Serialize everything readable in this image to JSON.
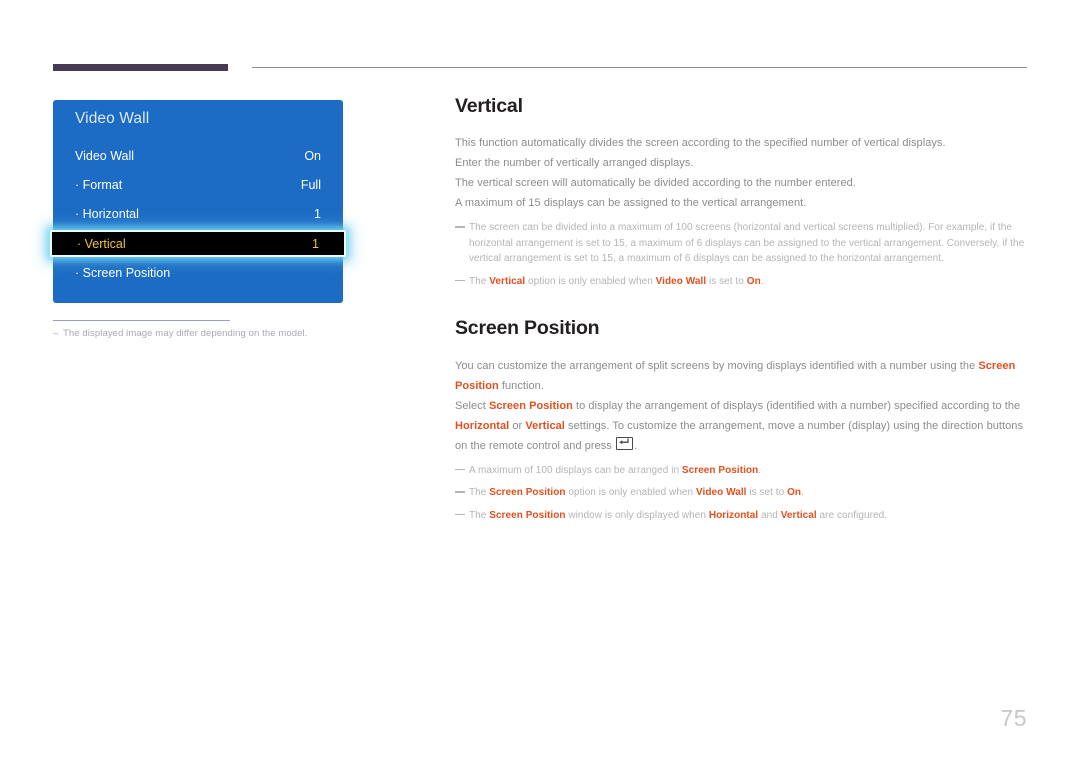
{
  "page": {
    "number": "75",
    "accent_color": "#E1511F",
    "osd_blue": "#1C6BC4",
    "osd_highlight_text": "#F5C13B",
    "rule_color": "#453B53"
  },
  "osd": {
    "title": "Video Wall",
    "rows": [
      {
        "label": "Video Wall",
        "value": "On",
        "selected": false
      },
      {
        "label": "· Format",
        "value": "Full",
        "selected": false
      },
      {
        "label": "· Horizontal",
        "value": "1",
        "selected": false
      },
      {
        "label": "· Vertical",
        "value": "1",
        "selected": true
      },
      {
        "label": "· Screen Position",
        "value": "",
        "selected": false
      }
    ],
    "caption": "The displayed image may differ depending on the model.",
    "caption_dash": "‒"
  },
  "article": {
    "vertical": {
      "heading": "Vertical",
      "paragraphs": [
        "This function automatically divides the screen according to the specified number of vertical displays.",
        "Enter the number of vertically arranged displays.",
        "The vertical screen will automatically be divided according to the number entered.",
        "A maximum of 15 displays can be assigned to the vertical arrangement."
      ],
      "note1": "The screen can be divided into a maximum of 100 screens (horizontal and vertical screens multiplied). For example, if the horizontal arrangement is set to 15, a maximum of 6 displays can be assigned to the vertical arrangement. Conversely, if the vertical arrangement is set to 15, a maximum of 6 displays can be assigned to the horizontal arrangement.",
      "note2": {
        "part1": "The ",
        "term1": "Vertical",
        "part2": " option is only enabled when ",
        "term2": "Video Wall",
        "part3": " is set to ",
        "term3": "On",
        "part4": "."
      }
    },
    "screen_position": {
      "heading": "Screen Position",
      "para1": {
        "part1": "You can customize the arrangement of split screens by moving displays identified with a number using the ",
        "term1": "Screen Position",
        "part2": " function."
      },
      "para2": {
        "part1": "Select ",
        "term1": "Screen Position",
        "part2": " to display the arrangement of displays (identified with a number) specified according to the ",
        "term2": "Horizontal",
        "part3": " or ",
        "term3": "Vertical",
        "part4": " settings. To customize the arrangement, move a number (display) using the direction buttons on the remote control and press ",
        "part5": "."
      },
      "note1": {
        "part1": "A maximum of 100 displays can be arranged in ",
        "term1": "Screen Position",
        "part2": "."
      },
      "note2": {
        "part1": "The ",
        "term1": "Screen Position",
        "part2": " option is only enabled when ",
        "term2": "Video Wall",
        "part3": " is set to ",
        "term3": "On",
        "part4": "."
      },
      "note3": {
        "part1": "The ",
        "term1": "Screen Position",
        "part2": " window is only displayed when ",
        "term2": "Horizontal",
        "part3": " and ",
        "term3": "Vertical",
        "part4": " are configured."
      }
    }
  },
  "icons": {
    "enter_key": "enter-key-icon"
  }
}
